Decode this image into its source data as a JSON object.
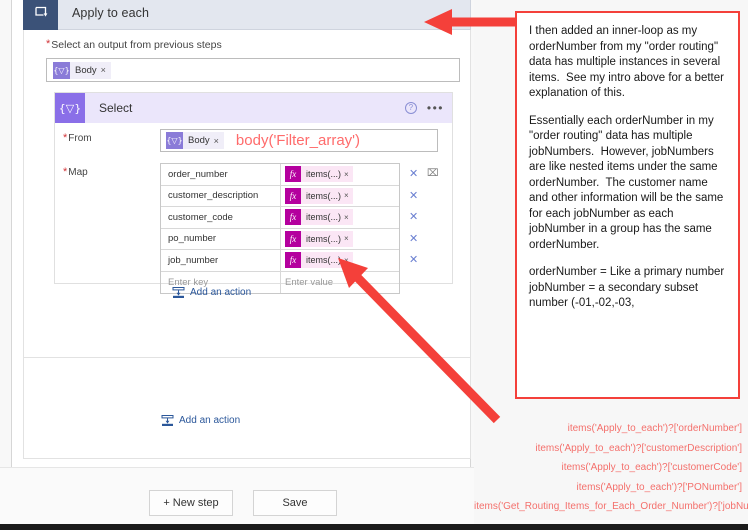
{
  "designer": {
    "apply_to_each": {
      "title": "Apply to each",
      "icon": "loop-icon",
      "select_output_label": "Select an output from previous steps",
      "required_marker": "*",
      "output_token": {
        "label": "Body",
        "icon_glyph": "{▽}",
        "remove_glyph": "×"
      },
      "add_action_label": "Add an action"
    },
    "select_card": {
      "title": "Select",
      "icon_glyph": "{▽}",
      "help_glyph": "?",
      "more_glyph": "•••",
      "from_label": "From",
      "map_label": "Map",
      "from_token": {
        "label": "Body",
        "icon_glyph": "{▽}",
        "remove_glyph": "×"
      },
      "from_annotation": "body('Filter_array')",
      "map_rows": [
        {
          "key": "order_number",
          "value": "items(...)",
          "has_trash": true
        },
        {
          "key": "customer_description",
          "value": "items(...)",
          "has_trash": false
        },
        {
          "key": "customer_code",
          "value": "items(...)",
          "has_trash": false
        },
        {
          "key": "po_number",
          "value": "items(...)",
          "has_trash": false
        },
        {
          "key": "job_number",
          "value": "items(...)",
          "has_trash": false
        }
      ],
      "empty_row": {
        "key_placeholder": "Enter key",
        "value_placeholder": "Enter value"
      },
      "fx_glyph": "fx",
      "remove_glyph": "×",
      "row_remove_glyph": "✕",
      "trash_glyph": "⌧"
    },
    "outer_add_action_label": "Add an action",
    "footer": {
      "new_step_label": "+ New step",
      "save_label": "Save"
    }
  },
  "annotation": {
    "paragraphs": [
      "I then added an inner-loop as my orderNumber from my \"order routing\" data has multiple instances in several items.  See my intro above for a better explanation of this.",
      "Essentially each orderNumber in my \"order routing\" data has multiple jobNumbers.  However, jobNumbers are like nested items under the same orderNumber.  The customer name and other information will be the same for each jobNumber as each jobNumber in a group has the same orderNumber.",
      "orderNumber = Like a primary number\njobNumber = a secondary subset number (-01,-02,-03,"
    ],
    "border_color": "#f4403a"
  },
  "expressions": [
    "items('Apply_to_each')?['orderNumber']",
    "items('Apply_to_each')?['customerDescription']",
    "items('Apply_to_each')?['customerCode']",
    "items('Apply_to_each')?['PONumber']",
    "items('Get_Routing_Items_for_Each_Order_Number')?['jobNumber']"
  ],
  "colors": {
    "arrow_red": "#f4403a",
    "expression_red": "#f4706c",
    "apply_to_each_icon": "#3b5278",
    "apply_to_each_header": "#e3e7ef",
    "select_icon": "#8a6fe8",
    "select_header": "#ebe6fb",
    "fx_token": "#b4009e",
    "link_blue": "#2b579a"
  },
  "arrows": [
    {
      "name": "arrow-to-apply-to-each-header",
      "direction": "left"
    },
    {
      "name": "arrow-to-map-value-column",
      "direction": "up-left"
    }
  ]
}
